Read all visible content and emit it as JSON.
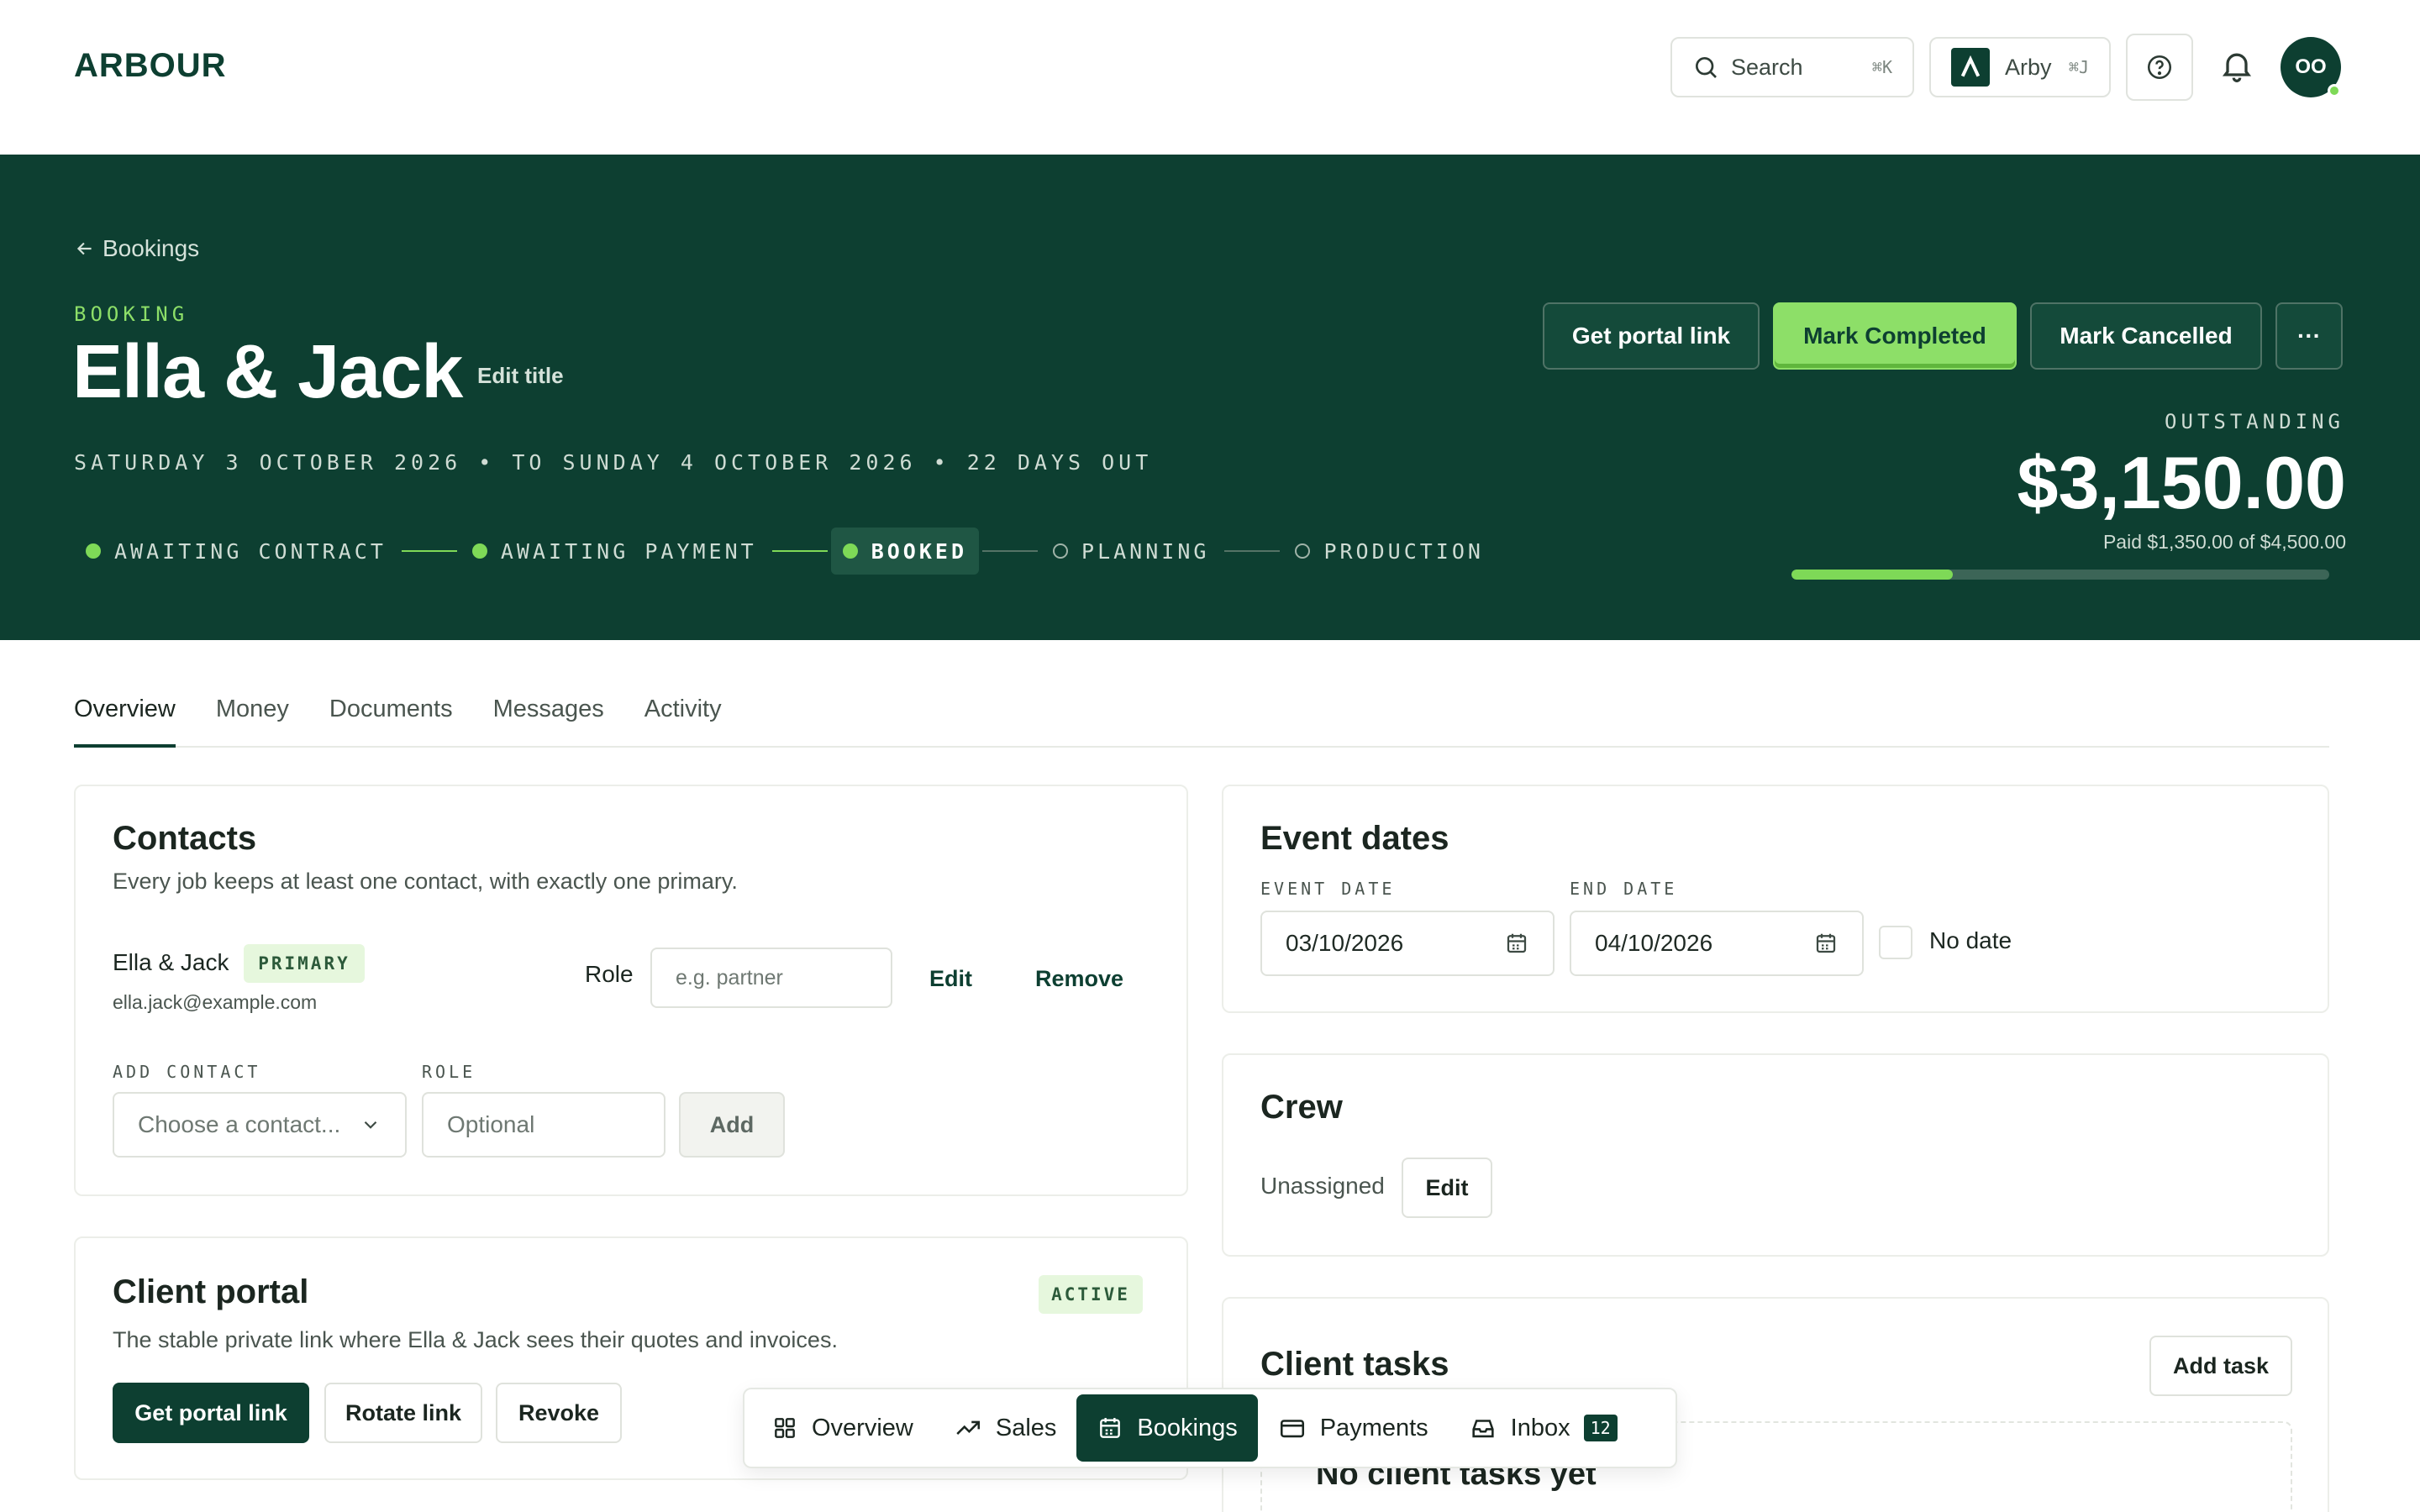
{
  "app": {
    "logo": "ARBOUR",
    "search_label": "Search",
    "search_shortcut": "⌘K",
    "assistant_label": "Arby",
    "assistant_shortcut": "⌘J",
    "avatar_initials": "OO",
    "icons": [
      "search-icon",
      "arby-logo-icon",
      "help-icon",
      "bell-icon"
    ]
  },
  "hero": {
    "back_label": "Bookings",
    "eyebrow": "BOOKING",
    "title": "Ella & Jack",
    "edit_title_label": "Edit title",
    "date_range": "SATURDAY 3 OCTOBER 2026  •  TO SUNDAY 4 OCTOBER 2026  •  22 DAYS OUT",
    "pipeline": [
      {
        "label": "AWAITING CONTRACT",
        "state": "done"
      },
      {
        "label": "AWAITING PAYMENT",
        "state": "done"
      },
      {
        "label": "BOOKED",
        "state": "current"
      },
      {
        "label": "PLANNING",
        "state": "todo"
      },
      {
        "label": "PRODUCTION",
        "state": "todo"
      }
    ],
    "actions": {
      "portal": "Get portal link",
      "complete": "Mark Completed",
      "cancel": "Mark Cancelled",
      "more": "···"
    },
    "outstanding_label": "OUTSTANDING",
    "outstanding_amount": "$3,150.00",
    "paid_text": "Paid $1,350.00 of $4,500.00",
    "paid_fraction": 0.3
  },
  "tabs": [
    "Overview",
    "Money",
    "Documents",
    "Messages",
    "Activity"
  ],
  "active_tab": "Overview",
  "contacts": {
    "title": "Contacts",
    "subtitle": "Every job keeps at least one contact, with exactly one primary.",
    "contact_name": "Ella & Jack",
    "primary_badge": "PRIMARY",
    "contact_email": "ella.jack@example.com",
    "role_label": "Role",
    "role_placeholder": "e.g. partner",
    "edit_label": "Edit",
    "remove_label": "Remove",
    "add_contact_label": "ADD CONTACT",
    "add_role_label": "ROLE",
    "choose_placeholder": "Choose a contact...",
    "optional_placeholder": "Optional",
    "add_button": "Add"
  },
  "portal": {
    "title": "Client portal",
    "status_badge": "ACTIVE",
    "subtitle": "The stable private link where Ella & Jack sees their quotes and invoices.",
    "get_link": "Get portal link",
    "rotate_link": "Rotate link",
    "revoke": "Revoke"
  },
  "event_dates": {
    "title": "Event dates",
    "event_date_label": "EVENT DATE",
    "event_date_value": "03/10/2026",
    "end_date_label": "END DATE",
    "end_date_value": "04/10/2026",
    "no_date_label": "No date"
  },
  "crew": {
    "title": "Crew",
    "status": "Unassigned",
    "edit_label": "Edit"
  },
  "client_tasks": {
    "title": "Client tasks",
    "add_task": "Add task",
    "empty_title": "No client tasks yet"
  },
  "bottom_nav": {
    "items": [
      "Overview",
      "Sales",
      "Bookings",
      "Payments",
      "Inbox"
    ],
    "active": "Bookings",
    "inbox_count": "12"
  },
  "colors": {
    "brand_dark": "#0d3f31",
    "accent_green": "#8ddf68",
    "badge_bg": "#e6f7dd"
  }
}
